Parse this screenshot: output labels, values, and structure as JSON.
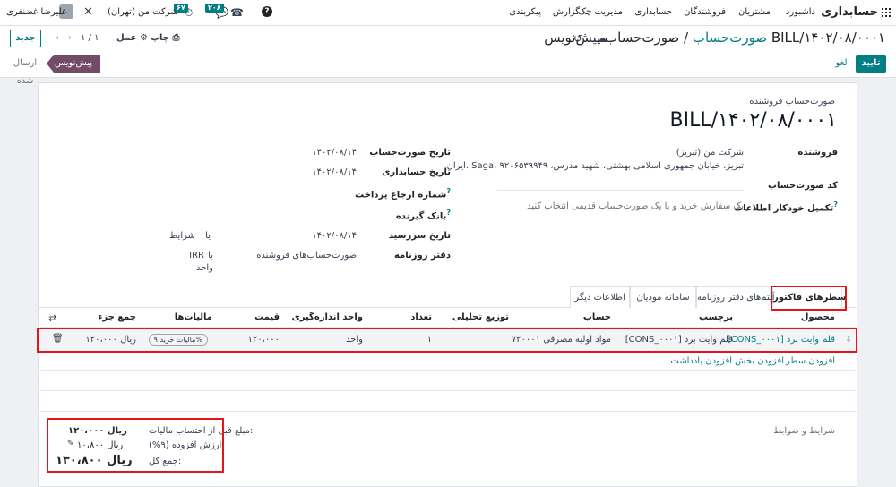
{
  "navbar": {
    "app_name": "حسابداری",
    "menu": [
      "داشبورد",
      "مشتریان",
      "فروشندگان",
      "حسابداری",
      "مدیریت چک",
      "گزارش",
      "پیکربندی"
    ],
    "user_name": "علیرضا غضنفری",
    "company": "شرکت من (تهران)",
    "messages_count": "۲۰۸",
    "activities_count": "۶۷"
  },
  "control_panel": {
    "new_label": "جدید",
    "pager": "۱ / ۱",
    "action_label": "عمل",
    "print_label": "چاپ",
    "breadcrumb_parent": "صورت‌حساب",
    "breadcrumb_separator": "/",
    "breadcrumb_current": "صورت‌حساب پیش‌نویس BILL/۱۴۰۲/۰۸/۰۰۰۱",
    "confirm_label": "تایید",
    "cancel_label": "لغو",
    "status_draft": "پیش‌نویس",
    "status_posted": "ارسال شده"
  },
  "form": {
    "doc_type": "صورت‌حساب فروشنده",
    "doc_name": "BILL/۱۴۰۲/۰۸/۰۰۰۱",
    "left": {
      "vendor_label": "فروشنده",
      "vendor_name": "شرکت من (تبریز)",
      "vendor_address": "ایران، Saga، تبریز، خیابان جمهوری اسلامی بهشتی، شهید مدرس، ۹۲۰۶۵۳۹۹۴۹",
      "bill_ref_label": "کد صورت‌حساب",
      "autocomplete_label": "تکمیل خودکار اطلاعات",
      "autocomplete_placeholder": "یک سفارش خرید و یا یک صورت‌حساب قدیمی انتخاب کنید"
    },
    "right": {
      "bill_date_label": "تاریخ صورت‌حساب",
      "bill_date": "۱۴۰۲/۰۸/۱۴",
      "accounting_date_label": "تاریخ حسابداری",
      "accounting_date": "۱۴۰۲/۰۸/۱۴",
      "payment_ref_label": "شماره ارجاع پرداخت",
      "recipient_bank_label": "بانک گیرنده",
      "due_date_label": "تاریخ سررسید",
      "due_date": "۱۴۰۲/۰۸/۱۴",
      "due_or": "یا",
      "due_terms": "شرایط",
      "journal_label": "دفتر روزنامه",
      "journal": "صورت‌حساب‌های فروشنده",
      "journal_in": "با",
      "currency": "IRR",
      "currency_unit": "واحد"
    }
  },
  "tabs": [
    "سطرهای فاکتور",
    "آیتم‌های دفتر روزنامه",
    "سامانه مودیان",
    "اطلاعات دیگر"
  ],
  "table": {
    "headers": [
      "محصول",
      "برچسب",
      "حساب",
      "توزیع تحلیلی",
      "تعداد",
      "واحد اندازه‌گیری",
      "قیمت",
      "مالیات‌ها",
      "جمع جزء"
    ],
    "row": {
      "product": "[CONS_۰۰۰۱] قلم وایت برد",
      "label": "[CONS_۰۰۰۱] قلم وایت برد",
      "account": "۷۲۰۰۰۱ مواد اولیه مصرفی",
      "quantity": "۱",
      "uom": "واحد",
      "price": "۱۲۰،۰۰۰",
      "tax": "مالیات خرید ۹%",
      "subtotal": "۱۲۰،۰۰۰ ریال"
    },
    "add_line": "افزودن سطر",
    "add_section": "افزودن بخش",
    "add_note": "افزودن یادداشت"
  },
  "terms_placeholder": "شرایط و ضوابط",
  "totals": {
    "untaxed_label": "مبلغ قبل از احتساب مالیات:",
    "untaxed_value": "ریال ۱۲۰،۰۰۰",
    "vat_label": "ارزش افزوده (۹%):",
    "vat_value": "ریال ۱۰،۸۰۰",
    "total_label": "جمع کل:",
    "total_value": "ریال ۱۳۰،۸۰۰"
  },
  "colors": {
    "accent": "#017e84",
    "draft": "#714b67",
    "highlight": "#e5141b"
  }
}
